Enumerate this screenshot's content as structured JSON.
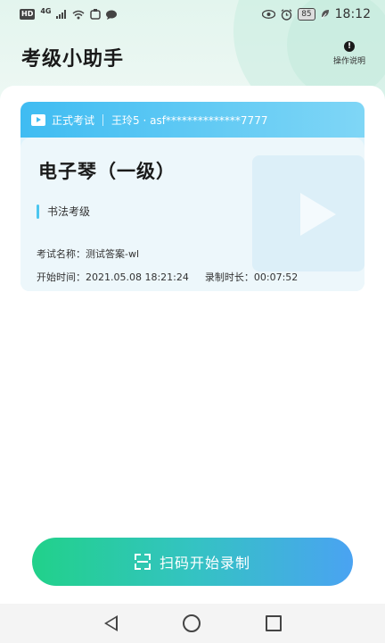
{
  "status_bar": {
    "hd": "HD",
    "network": "4G",
    "battery": "85",
    "time": "18:12",
    "icons_left": [
      "signal-icon",
      "wifi-icon",
      "app-notification-icon",
      "message-icon"
    ],
    "icons_right": [
      "eye-icon",
      "alarm-icon",
      "leaf-icon"
    ]
  },
  "header": {
    "title": "考级小助手",
    "help_label": "操作说明",
    "help_icon_glyph": "!"
  },
  "exam_card": {
    "type_label": "正式考试",
    "candidate": "王玲5 · asf**************7777",
    "course_title": "电子琴（一级）",
    "category_tag": "书法考级",
    "exam_name": "考试名称：测试答案-wl",
    "start_time": "开始时间：2021.05.08 18:21:24",
    "duration": "录制时长：00:07:52"
  },
  "cta": {
    "label": "扫码开始录制"
  },
  "colors": {
    "accent_blue": "#3fbcf2",
    "cta_start": "#21d18a",
    "cta_end": "#4aa3f2"
  }
}
